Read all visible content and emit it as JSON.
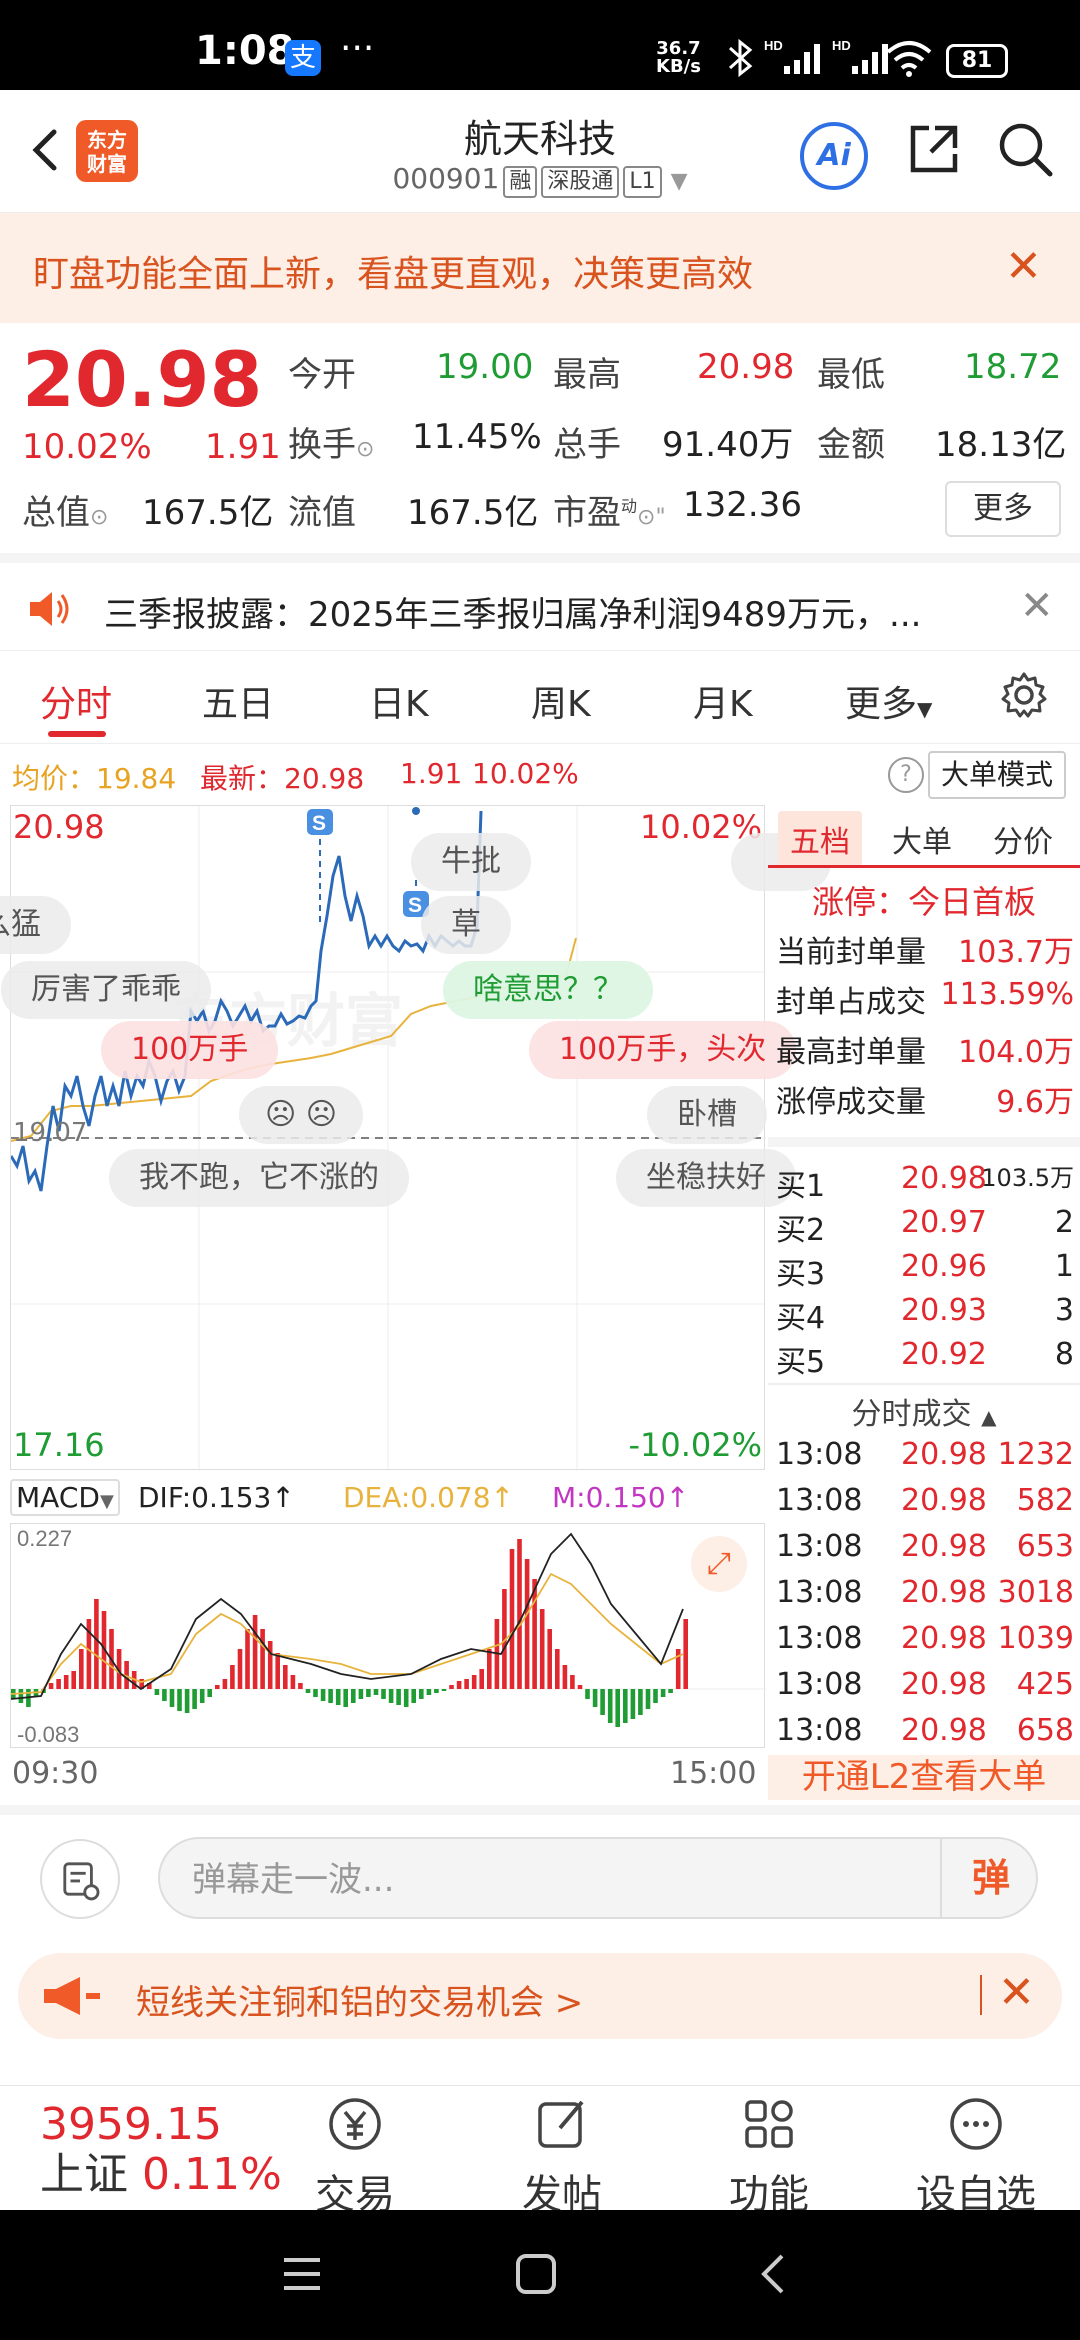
{
  "status_bar": {
    "time": "1:08",
    "app_badge": "支",
    "more": "···",
    "net_speed_value": "36.7",
    "net_speed_unit": "KB/s",
    "signal1": "HD",
    "signal2": "HD",
    "battery": "81"
  },
  "header": {
    "logo_line1": "东方",
    "logo_line2": "财富",
    "title": "航天科技",
    "code": "000901",
    "tags": [
      "融",
      "深股通",
      "L1"
    ],
    "ai_label": "Ai"
  },
  "notice": {
    "text": "盯盘功能全面上新，看盘更直观，决策更高效",
    "close": "✕"
  },
  "quote": {
    "price": "20.98",
    "change_pct": "10.02%",
    "change": "1.91",
    "open_label": "今开",
    "open": "19.00",
    "high_label": "最高",
    "high": "20.98",
    "low_label": "最低",
    "low": "18.72",
    "turnover_label": "换手",
    "turnover": "11.45%",
    "volume_label": "总手",
    "volume": "91.40万",
    "amount_label": "金额",
    "amount": "18.13亿",
    "mktcap_label": "总值",
    "mktcap": "167.5亿",
    "float_label": "流值",
    "float": "167.5亿",
    "pe_label": "市盈",
    "pe_sup": "动",
    "pe": "132.36",
    "more": "更多"
  },
  "ticker": {
    "text": "三季报披露：2025年三季报归属净利润9489万元，...",
    "close": "✕"
  },
  "tabs": [
    "分时",
    "五日",
    "日K",
    "周K",
    "月K",
    "更多"
  ],
  "chart_info": {
    "avg_label": "均价：",
    "avg": "19.84",
    "latest_label": "最新：",
    "latest": "20.98",
    "change": "1.91",
    "pct": "10.02%",
    "help": "?",
    "big_order_mode": "大单模式"
  },
  "chart": {
    "top_price": "20.98",
    "top_pct": "10.02%",
    "mid_price": "19.07",
    "bottom_price": "17.16",
    "bottom_pct": "-10.02%",
    "watermark": "东方财富",
    "marker": "S",
    "danmu": [
      "牛批",
      "么猛",
      "草",
      "厉害了乖乖",
      "啥意思？？",
      "100万手",
      "100万手，头次",
      "卧槽",
      "我不跑，它不涨的",
      "坐稳扶好"
    ],
    "time_start": "09:30",
    "time_end": "15:00"
  },
  "macd": {
    "selector": "MACD",
    "dif": "DIF:0.153↑",
    "dea": "DEA:0.078↑",
    "m": "M:0.150↑",
    "top": "0.227",
    "bottom": "-0.083"
  },
  "right_panel": {
    "tabs": [
      "五档",
      "大单",
      "分价"
    ],
    "limit_label": "涨停：今日首板",
    "stats": [
      {
        "label": "当前封单量",
        "value": "103.7万"
      },
      {
        "label": "封单占成交",
        "value": "113.59%"
      },
      {
        "label": "最高封单量",
        "value": "104.0万"
      },
      {
        "label": "涨停成交量",
        "value": "9.6万"
      }
    ],
    "bids": [
      {
        "label": "买1",
        "price": "20.98",
        "vol": "103.5万"
      },
      {
        "label": "买2",
        "price": "20.97",
        "vol": "2"
      },
      {
        "label": "买3",
        "price": "20.96",
        "vol": "1"
      },
      {
        "label": "买4",
        "price": "20.93",
        "vol": "3"
      },
      {
        "label": "买5",
        "price": "20.92",
        "vol": "8"
      }
    ],
    "trades_title": "分时成交",
    "trades": [
      {
        "time": "13:08",
        "price": "20.98",
        "vol": "1232"
      },
      {
        "time": "13:08",
        "price": "20.98",
        "vol": "582"
      },
      {
        "time": "13:08",
        "price": "20.98",
        "vol": "653"
      },
      {
        "time": "13:08",
        "price": "20.98",
        "vol": "3018"
      },
      {
        "time": "13:08",
        "price": "20.98",
        "vol": "1039"
      },
      {
        "time": "13:08",
        "price": "20.98",
        "vol": "425"
      },
      {
        "time": "13:08",
        "price": "20.98",
        "vol": "658"
      }
    ],
    "l2_cta": "开通L2查看大单"
  },
  "input_bar": {
    "placeholder": "弹幕走一波...",
    "send": "弹"
  },
  "promo": {
    "text": "短线关注铜和铝的交易机会 >",
    "close": "✕"
  },
  "bottom_nav": {
    "index_value": "3959.15",
    "index_name": "上证",
    "index_pct": "0.11%",
    "items": [
      "交易",
      "发帖",
      "功能",
      "设自选"
    ]
  },
  "colors": {
    "up": "#e0282e",
    "down": "#1f9c34",
    "accent": "#f05a28",
    "price_line": "#2a6ab8",
    "avg_line": "#e8b33c"
  }
}
